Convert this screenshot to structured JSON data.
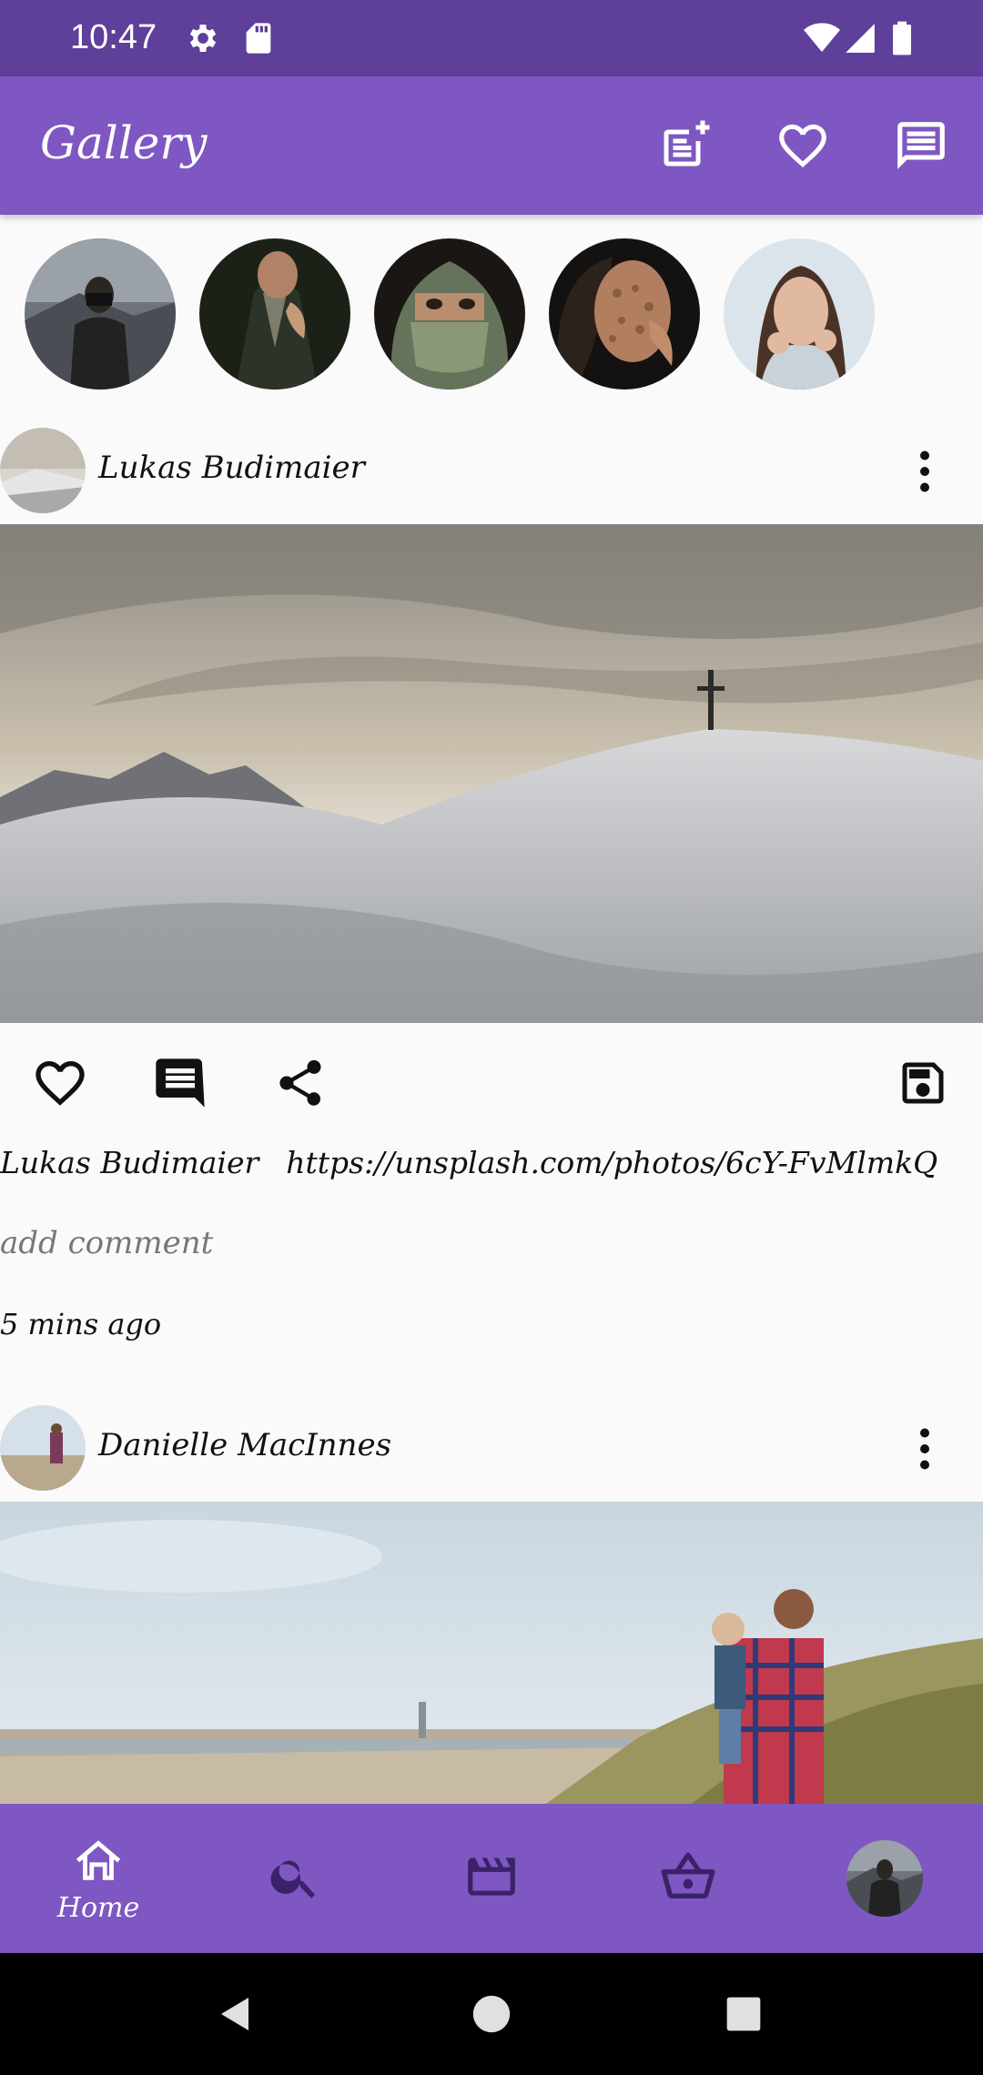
{
  "status_bar": {
    "time": "10:47",
    "icons": [
      "settings-icon",
      "sd-card-icon",
      "wifi-icon",
      "signal-icon",
      "battery-icon"
    ]
  },
  "app_bar": {
    "title": "Gallery",
    "actions": [
      "add-post-icon",
      "heart-icon",
      "message-icon"
    ]
  },
  "stories": [
    "story-photographer",
    "story-suit-man",
    "story-veiled-woman",
    "story-lace-shadow-woman",
    "story-smiling-woman"
  ],
  "posts": [
    {
      "author": "Lukas Budimaier",
      "image": "snowy-mountain-cross-photo",
      "caption_author": "Lukas Budimaier",
      "caption_text": "https://unsplash.com/photos/6cY-FvMlmkQ",
      "add_comment_placeholder": "add comment",
      "time_ago": "5 mins ago"
    },
    {
      "author": "Danielle MacInnes",
      "image": "father-child-beach-photo"
    }
  ],
  "bottom_nav": {
    "items": [
      {
        "label": "Home",
        "icon": "home-icon",
        "active": true
      },
      {
        "label": "",
        "icon": "search-icon"
      },
      {
        "label": "",
        "icon": "movie-icon"
      },
      {
        "label": "",
        "icon": "basket-icon"
      },
      {
        "label": "",
        "icon": "profile-avatar"
      }
    ]
  },
  "colors": {
    "primary": "#7e57c2",
    "primary_dark": "#5e3f99",
    "background": "#fafafa",
    "icon_dark": "#212121"
  }
}
